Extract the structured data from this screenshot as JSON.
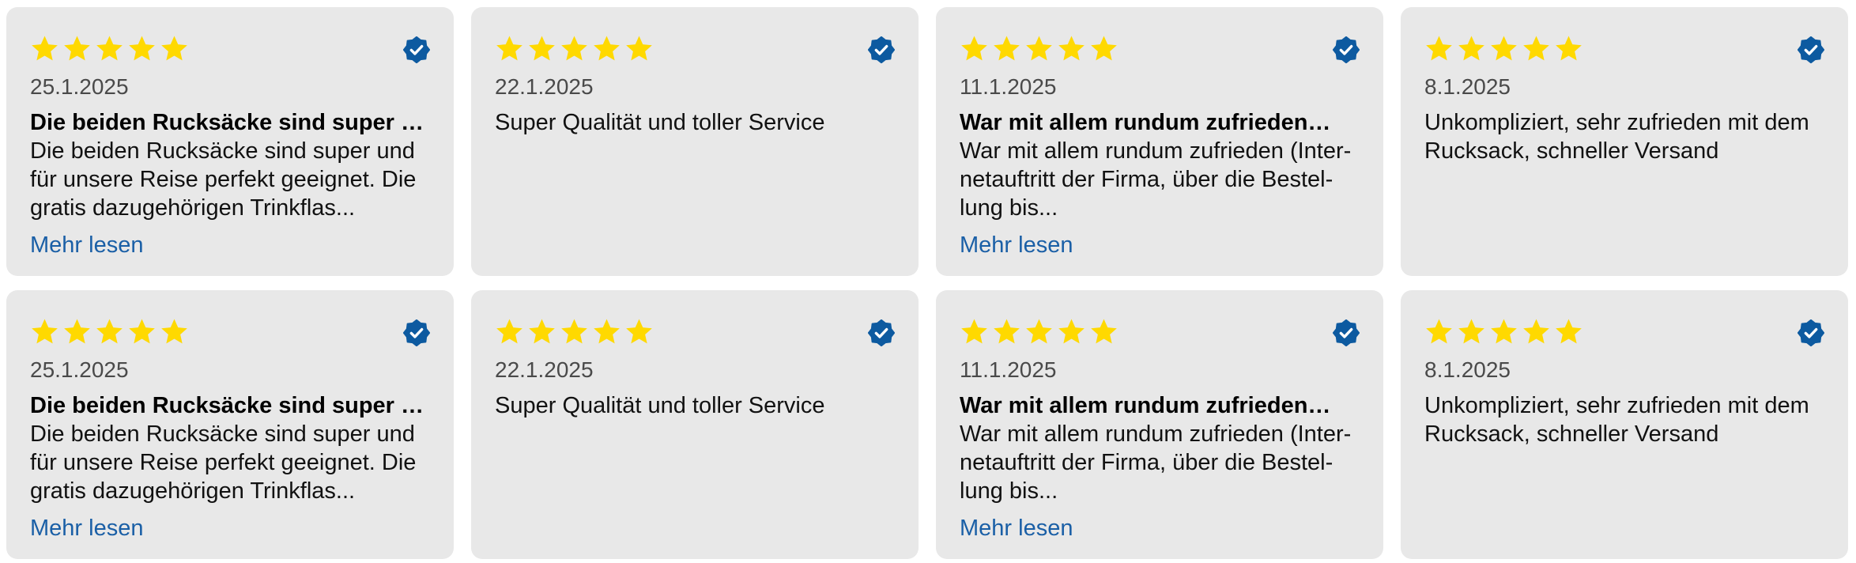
{
  "colors": {
    "card_bg": "#e8e8e8",
    "star": "#ffd900",
    "verified_badge": "#0d5aa0",
    "link": "#1a5fa6"
  },
  "rating_icon": "star-icon",
  "verified_icon": "verified-badge-icon",
  "reviews": [
    {
      "rating": 5,
      "date": "25.1.2025",
      "headline": "Die beiden Rucksäcke sind super …",
      "body": "Die beiden Rucksäcke sind super und für unsere Reise perfekt geeignet. Die gratis dazugehörigen Trinkflas...",
      "more_label": "Mehr lesen"
    },
    {
      "rating": 5,
      "date": "22.1.2025",
      "headline": "",
      "body": "Super Qualität und toller Service",
      "more_label": ""
    },
    {
      "rating": 5,
      "date": "11.1.2025",
      "headline": "War mit allem rundum zufrieden…",
      "body": "War mit allem rundum zufrieden (Inter­netauftritt der Firma, über die Bestel­lung bis...",
      "more_label": "Mehr lesen"
    },
    {
      "rating": 5,
      "date": "8.1.2025",
      "headline": "",
      "body": "Unkompliziert, sehr zufrieden mit dem Rucksack, schneller Versand",
      "more_label": ""
    },
    {
      "rating": 5,
      "date": "25.1.2025",
      "headline": "Die beiden Rucksäcke sind super …",
      "body": "Die beiden Rucksäcke sind super und für unsere Reise perfekt geeignet. Die gratis dazugehörigen Trinkflas...",
      "more_label": "Mehr lesen"
    },
    {
      "rating": 5,
      "date": "22.1.2025",
      "headline": "",
      "body": "Super Qualität und toller Service",
      "more_label": ""
    },
    {
      "rating": 5,
      "date": "11.1.2025",
      "headline": "War mit allem rundum zufrieden…",
      "body": "War mit allem rundum zufrieden (Inter­netauftritt der Firma, über die Bestel­lung bis...",
      "more_label": "Mehr lesen"
    },
    {
      "rating": 5,
      "date": "8.1.2025",
      "headline": "",
      "body": "Unkompliziert, sehr zufrieden mit dem Rucksack, schneller Versand",
      "more_label": ""
    }
  ]
}
